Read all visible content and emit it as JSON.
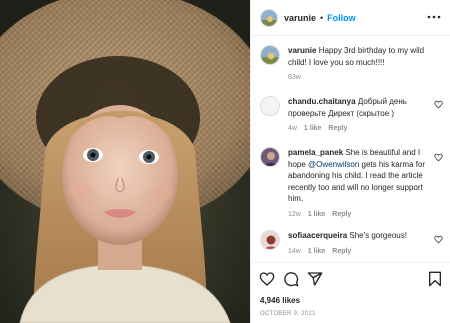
{
  "post": {
    "author": "varunie",
    "follow_label": "Follow",
    "likes": "4,946 likes",
    "date": "OCTOBER 9, 2021"
  },
  "comments": [
    {
      "user": "varunie",
      "text": "Happy 3rd birthday to my wild child! I love you so much!!!!",
      "time": "63w",
      "likes": "",
      "reply": ""
    },
    {
      "user": "chandu.chaitanya",
      "text": "Добрый день проверьте Директ (скрытое )",
      "time": "4w",
      "likes": "1 like",
      "reply": "Reply"
    },
    {
      "user": "pamela_panek",
      "text_before": "She is beautiful and I hope",
      "mention": "@Owenwilson",
      "text_after": "gets his karma for abandoning his child. I read the article recently too and will no longer support him.",
      "time": "12w",
      "likes": "1 like",
      "reply": "Reply"
    },
    {
      "user": "sofiaacerqueira",
      "text": "She's gorgeous!",
      "time": "14w",
      "likes": "1 like",
      "reply": "Reply"
    }
  ],
  "icons": {
    "more": "more-options-icon",
    "like": "heart-icon",
    "comment": "comment-icon",
    "share": "share-icon",
    "save": "bookmark-icon"
  },
  "colors": {
    "link_blue": "#0095f6",
    "mention_blue": "#00376b",
    "muted": "#8e8e8e"
  }
}
